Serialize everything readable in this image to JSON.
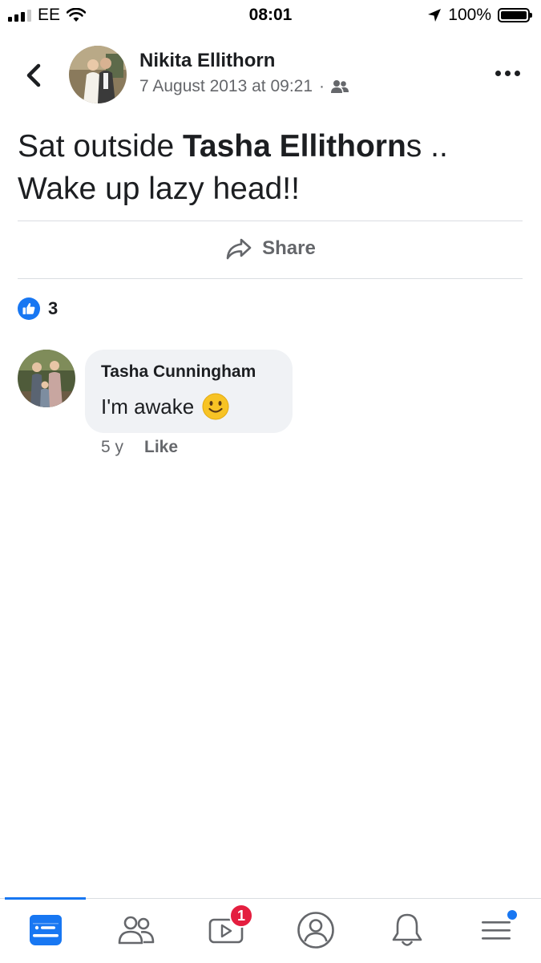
{
  "status_bar": {
    "carrier": "EE",
    "time": "08:01",
    "battery": "100%"
  },
  "post": {
    "author": "Nikita Ellithorn",
    "timestamp": "7 August 2013 at 09:21",
    "separator": "·",
    "text_before": "Sat outside ",
    "text_tag": "Tasha Ellithorn",
    "text_after": "s .. Wake up lazy head!!",
    "share_label": "Share",
    "reaction_count": "3"
  },
  "comment": {
    "author": "Tasha Cunningham",
    "text": "I'm awake",
    "time": "5 y",
    "like_label": "Like"
  },
  "bottom_nav": {
    "watch_badge": "1"
  },
  "colors": {
    "accent": "#1877f2",
    "badge": "#e41e3f",
    "secondary_text": "#65676b"
  }
}
